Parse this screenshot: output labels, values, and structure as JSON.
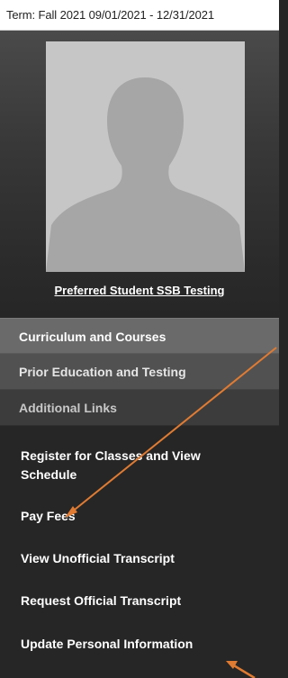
{
  "term": {
    "label": "Term: Fall 2021 09/01/2021 - 12/31/2021"
  },
  "profile": {
    "name": "Preferred Student SSB Testing"
  },
  "sections": [
    {
      "label": "Curriculum and Courses"
    },
    {
      "label": "Prior Education and Testing"
    },
    {
      "label": "Additional Links"
    }
  ],
  "links": [
    {
      "label": "Register for Classes and View Schedule"
    },
    {
      "label": "Pay Fees"
    },
    {
      "label": "View Unofficial Transcript"
    },
    {
      "label": "Request Official Transcript"
    },
    {
      "label": "Update Personal Information"
    }
  ],
  "colors": {
    "annotation_arrow": "#e07b32",
    "panel_background": "#262626"
  }
}
